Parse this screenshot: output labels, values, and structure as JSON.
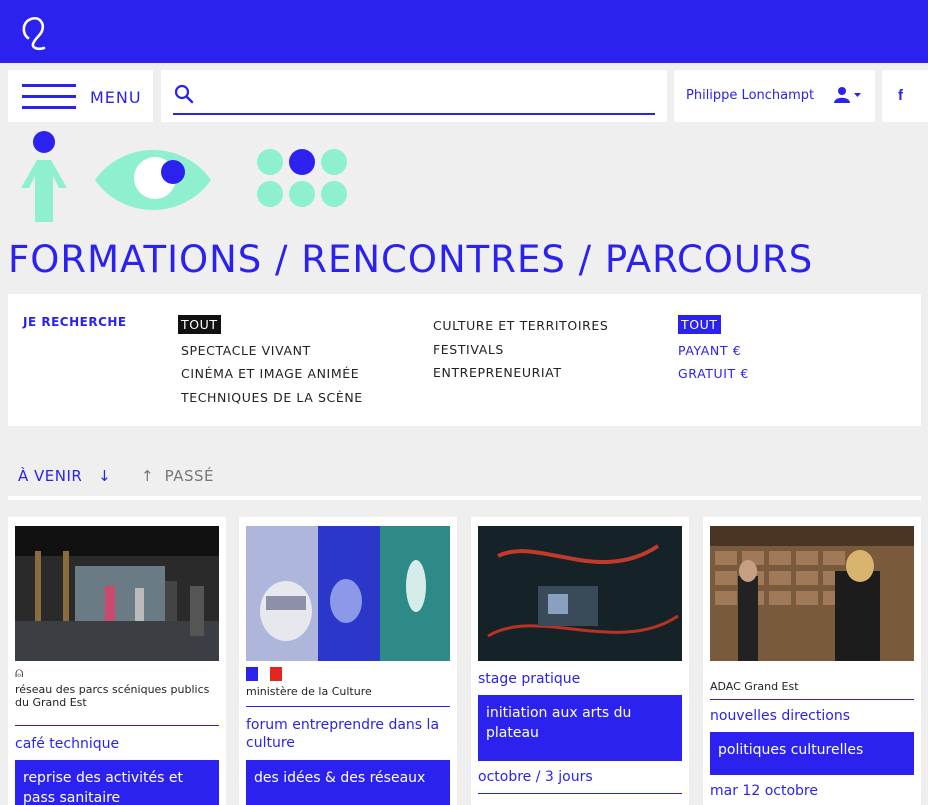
{
  "header": {
    "menu_label": "MENU",
    "search": {
      "placeholder": "",
      "value": ""
    },
    "user_name": "Philippe Lonchampt",
    "facebook": "f"
  },
  "page": {
    "title": "FORMATIONS / RENCONTRES / PARCOURS"
  },
  "filters": {
    "label": "JE RECHERCHE",
    "disciplines_col1": [
      "TOUT",
      "SPECTACLE VIVANT",
      "CINÉMA ET IMAGE ANIMÉE",
      "TECHNIQUES DE LA SCÈNE"
    ],
    "disciplines_col2": [
      "CULTURE ET TERRITOIRES",
      "FESTIVALS",
      "ENTREPRENEURIAT"
    ],
    "price": [
      "TOUT",
      "PAYANT €",
      "GRATUIT €"
    ]
  },
  "tabs": {
    "upcoming": "À VENIR",
    "past": "PASSÉ"
  },
  "cards": [
    {
      "org": "réseau des parcs scéniques publics du Grand Est",
      "category": "café technique",
      "title": "reprise des activités et pass sanitaire",
      "date": ""
    },
    {
      "org": "ministère de la Culture",
      "category": "forum entreprendre dans la culture",
      "title": "des idées & des réseaux",
      "date": ""
    },
    {
      "org": "",
      "category": "stage pratique",
      "title": "initiation aux arts du plateau",
      "date": "octobre / 3 jours"
    },
    {
      "org": "ADAC Grand Est",
      "category": "nouvelles directions",
      "title": "politiques culturelles",
      "date": "mar 12 octobre"
    }
  ],
  "colors": {
    "accent": "#2b22f0",
    "mint": "#8ff0cf",
    "background": "#efefef"
  }
}
